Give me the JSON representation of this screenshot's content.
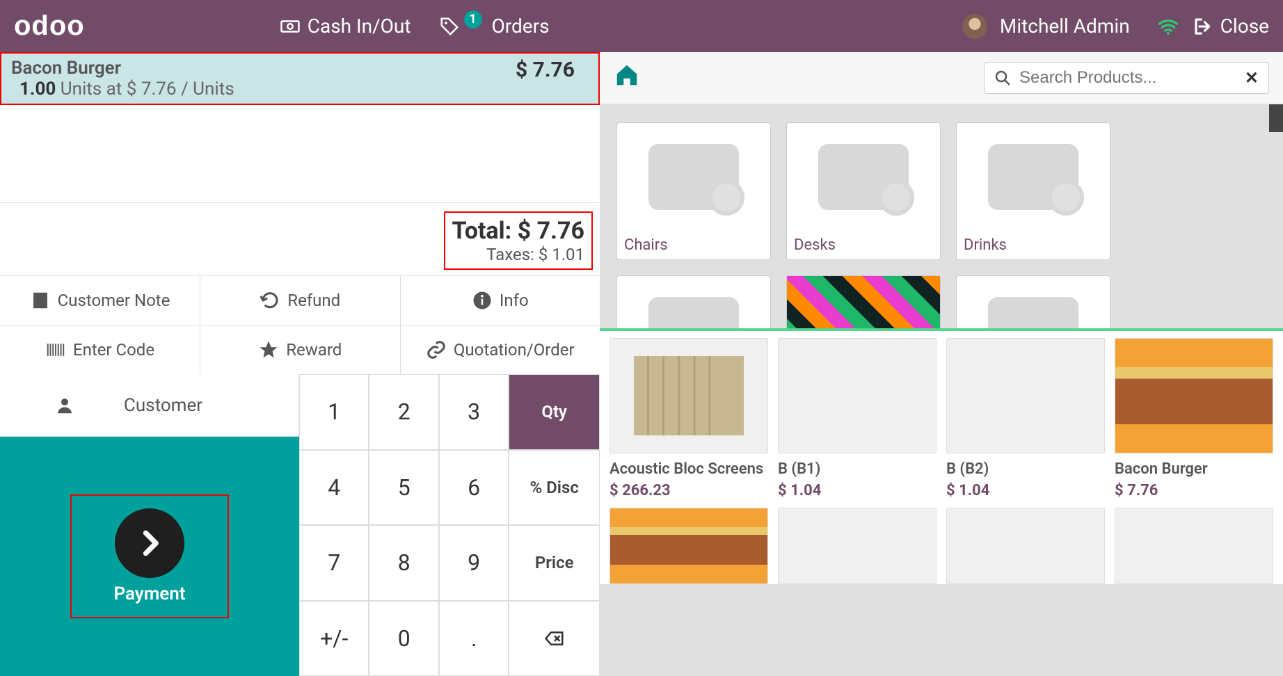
{
  "topbar": {
    "logo": "odoo",
    "cash": "Cash In/Out",
    "orders": "Orders",
    "orders_badge": "1",
    "user": "Mitchell Admin",
    "close": "Close"
  },
  "order": {
    "line_name": "Bacon Burger",
    "line_qty": "1.00",
    "line_unit_label": "Units at",
    "line_unit_price": "$ 7.76",
    "line_unit_suffix": "/ Units",
    "line_total": "$ 7.76"
  },
  "totals": {
    "total_label": "Total:",
    "total_value": "$ 7.76",
    "taxes_label": "Taxes:",
    "taxes_value": "$ 1.01"
  },
  "actions": {
    "customer_note": "Customer Note",
    "refund": "Refund",
    "info": "Info",
    "enter_code": "Enter Code",
    "reward": "Reward",
    "quotation": "Quotation/Order"
  },
  "customer_btn": "Customer",
  "payment_btn": "Payment",
  "numpad": {
    "qty": "Qty",
    "disc": "% Disc",
    "price": "Price",
    "plusminus": "+/-",
    "dot": "."
  },
  "search_placeholder": "Search Products...",
  "categories": [
    "Chairs",
    "Desks",
    "Drinks"
  ],
  "products": [
    {
      "name": "Acoustic Bloc Screens",
      "price": "$ 266.23"
    },
    {
      "name": "B (B1)",
      "price": "$ 1.04"
    },
    {
      "name": "B (B2)",
      "price": "$ 1.04"
    },
    {
      "name": "Bacon Burger",
      "price": "$ 7.76"
    }
  ]
}
